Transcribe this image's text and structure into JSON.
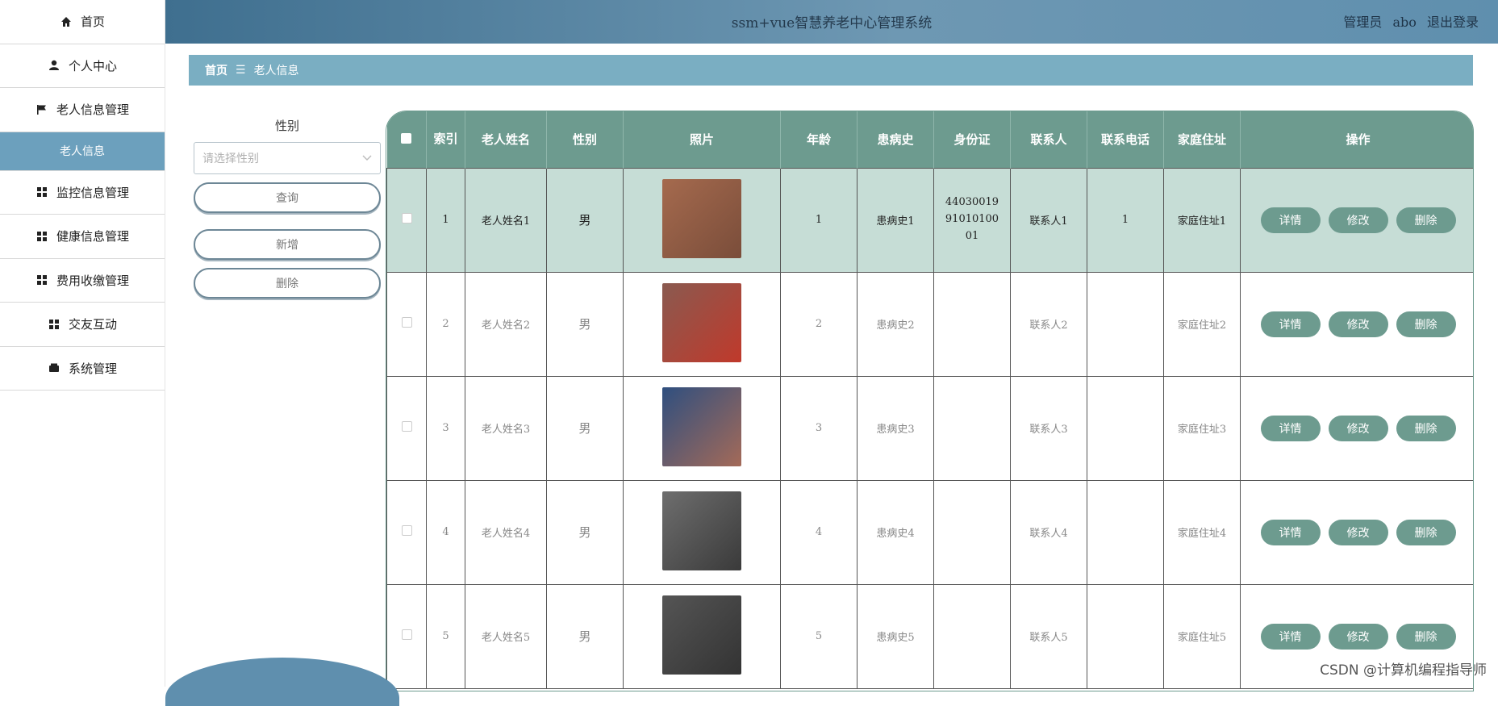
{
  "header": {
    "title": "ssm+vue智慧养老中心管理系统",
    "role": "管理员",
    "username": "abo",
    "logout": "退出登录"
  },
  "sidebar": {
    "items": [
      {
        "label": "首页",
        "icon": "home-icon"
      },
      {
        "label": "个人中心",
        "icon": "user-icon"
      },
      {
        "label": "老人信息管理",
        "icon": "flag-icon"
      },
      {
        "label": "老人信息",
        "icon": "",
        "sub": true
      },
      {
        "label": "监控信息管理",
        "icon": "grid-icon"
      },
      {
        "label": "健康信息管理",
        "icon": "grid-icon"
      },
      {
        "label": "费用收缴管理",
        "icon": "grid-icon"
      },
      {
        "label": "交友互动",
        "icon": "grid-icon"
      },
      {
        "label": "系统管理",
        "icon": "wallet-icon"
      }
    ]
  },
  "breadcrumb": {
    "home": "首页",
    "separator": "☰",
    "current": "老人信息"
  },
  "filter": {
    "label": "性别",
    "placeholder": "请选择性别",
    "query_btn": "查询",
    "add_btn": "新增",
    "delete_btn": "删除"
  },
  "table": {
    "headers": [
      "",
      "索引",
      "老人姓名",
      "性别",
      "照片",
      "年龄",
      "患病史",
      "身份证",
      "联系人",
      "联系电话",
      "家庭住址",
      "操作"
    ],
    "rows": [
      {
        "index": "1",
        "name": "老人姓名1",
        "gender": "男",
        "age": "1",
        "history": "患病史1",
        "id_card": "440300199101010001",
        "contact": "联系人1",
        "phone": "1",
        "address": "家庭住址1"
      },
      {
        "index": "2",
        "name": "老人姓名2",
        "gender": "男",
        "age": "2",
        "history": "患病史2",
        "id_card": "",
        "contact": "联系人2",
        "phone": "",
        "address": "家庭住址2"
      },
      {
        "index": "3",
        "name": "老人姓名3",
        "gender": "男",
        "age": "3",
        "history": "患病史3",
        "id_card": "",
        "contact": "联系人3",
        "phone": "",
        "address": "家庭住址3"
      },
      {
        "index": "4",
        "name": "老人姓名4",
        "gender": "男",
        "age": "4",
        "history": "患病史4",
        "id_card": "",
        "contact": "联系人4",
        "phone": "",
        "address": "家庭住址4"
      },
      {
        "index": "5",
        "name": "老人姓名5",
        "gender": "男",
        "age": "5",
        "history": "患病史5",
        "id_card": "",
        "contact": "联系人5",
        "phone": "",
        "address": "家庭住址5"
      }
    ],
    "ops": {
      "detail": "详情",
      "edit": "修改",
      "delete": "删除"
    }
  },
  "watermark": "CSDN @计算机编程指导师",
  "colors": {
    "accent": "#6d9b8f",
    "sidebar_active": "#6ca0bd",
    "breadcrumb": "#7aaec2"
  }
}
